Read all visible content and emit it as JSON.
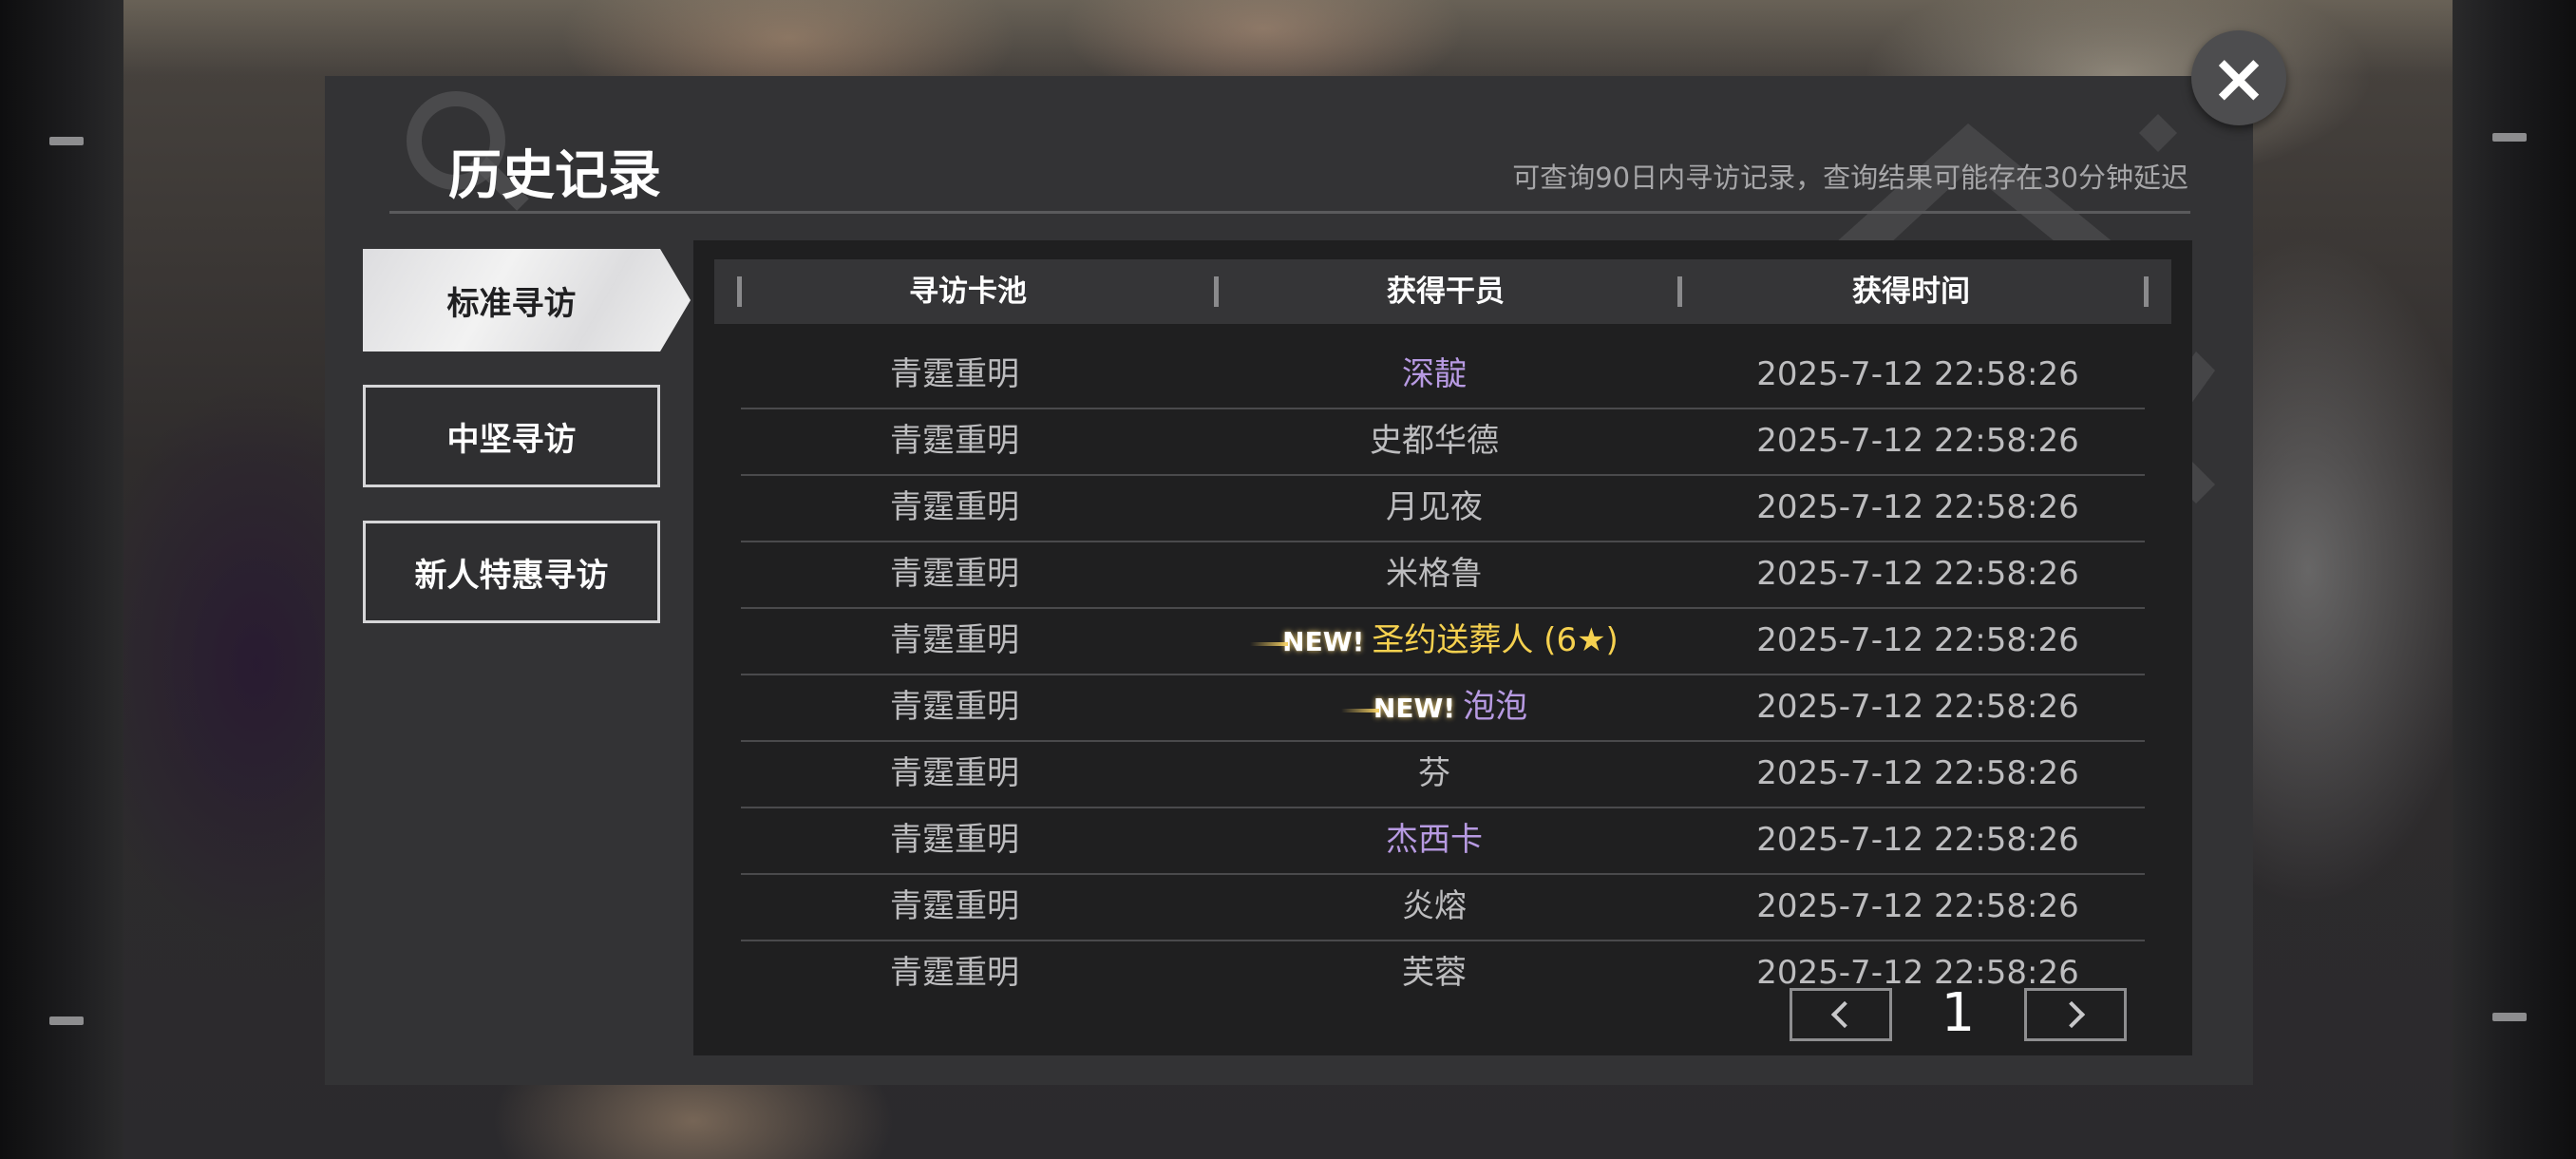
{
  "dialog": {
    "title": "历史记录",
    "subtitle": "可查询90日内寻访记录，查询结果可能存在30分钟延迟",
    "close_icon": "×"
  },
  "tabs": [
    {
      "label": "标准寻访",
      "active": true
    },
    {
      "label": "中坚寻访",
      "active": false
    },
    {
      "label": "新人特惠寻访",
      "active": false
    }
  ],
  "table": {
    "headers": [
      "寻访卡池",
      "获得干员",
      "获得时间"
    ],
    "new_label": "NEW!",
    "rows": [
      {
        "pool": "青霆重明",
        "operator": "深靛",
        "time": "2025-7-12 22:58:26",
        "rarity": "purple",
        "new": false
      },
      {
        "pool": "青霆重明",
        "operator": "史都华德",
        "time": "2025-7-12 22:58:26",
        "rarity": "normal",
        "new": false
      },
      {
        "pool": "青霆重明",
        "operator": "月见夜",
        "time": "2025-7-12 22:58:26",
        "rarity": "normal",
        "new": false
      },
      {
        "pool": "青霆重明",
        "operator": "米格鲁",
        "time": "2025-7-12 22:58:26",
        "rarity": "normal",
        "new": false
      },
      {
        "pool": "青霆重明",
        "operator": "圣约送葬人 (6★)",
        "time": "2025-7-12 22:58:26",
        "rarity": "gold",
        "new": true
      },
      {
        "pool": "青霆重明",
        "operator": "泡泡",
        "time": "2025-7-12 22:58:26",
        "rarity": "purple",
        "new": true
      },
      {
        "pool": "青霆重明",
        "operator": "芬",
        "time": "2025-7-12 22:58:26",
        "rarity": "normal",
        "new": false
      },
      {
        "pool": "青霆重明",
        "operator": "杰西卡",
        "time": "2025-7-12 22:58:26",
        "rarity": "purple",
        "new": false
      },
      {
        "pool": "青霆重明",
        "operator": "炎熔",
        "time": "2025-7-12 22:58:26",
        "rarity": "normal",
        "new": false
      },
      {
        "pool": "青霆重明",
        "operator": "芙蓉",
        "time": "2025-7-12 22:58:26",
        "rarity": "normal",
        "new": false
      }
    ]
  },
  "pagination": {
    "current_page": "1"
  },
  "colors": {
    "gold": "#f6d14f",
    "purple": "#b79ae2",
    "normal": "#bdbdbf"
  }
}
